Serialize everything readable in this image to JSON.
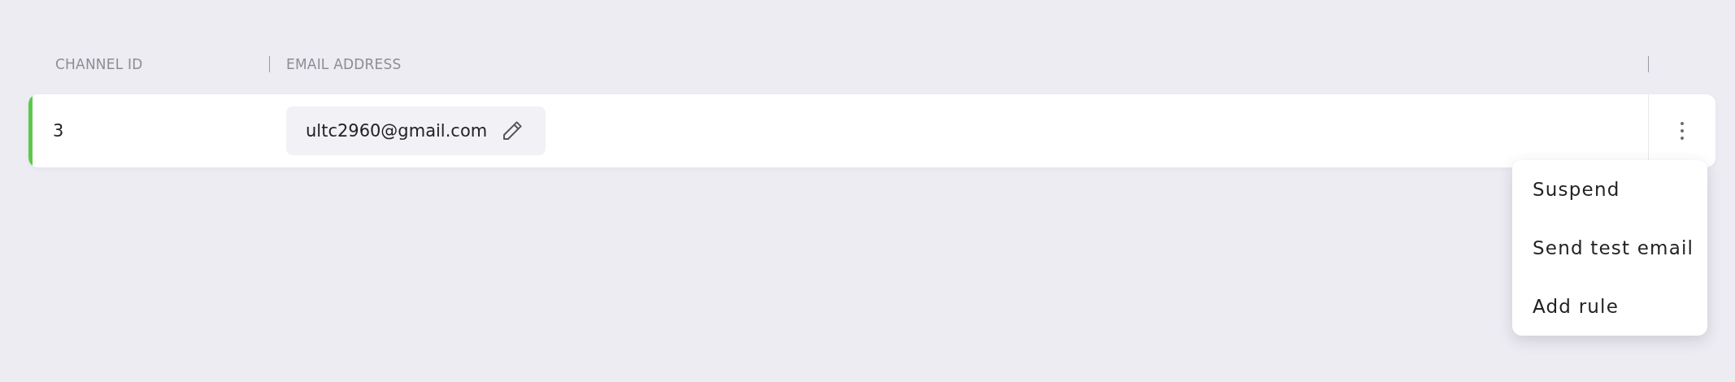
{
  "table": {
    "columns": [
      "CHANNEL ID",
      "EMAIL ADDRESS"
    ],
    "rows": [
      {
        "channel_id": "3",
        "email": "ultc2960@gmail.com",
        "color": "#5cc94a",
        "menu_expanded": true
      }
    ]
  },
  "menu": {
    "items": [
      "Suspend",
      "Send test email",
      "Add rule"
    ]
  }
}
